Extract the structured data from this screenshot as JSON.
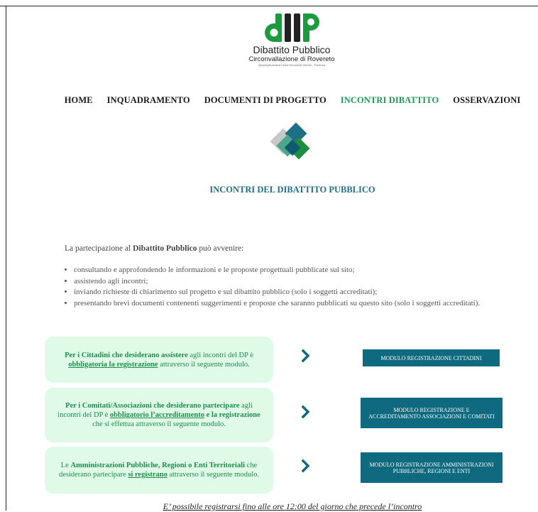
{
  "logo": {
    "title": "Dibattito Pubblico",
    "subtitle": "Circonvallazione di Rovereto",
    "tagline": "Quadruplicamento linea ferroviaria Verona - Fortezza",
    "colors": {
      "green": "#1d9a3e",
      "dark": "#222222"
    }
  },
  "nav": {
    "items": [
      {
        "label": "HOME",
        "active": false
      },
      {
        "label": "INQUADRAMENTO",
        "active": false
      },
      {
        "label": "DOCUMENTI DI PROGETTO",
        "active": false
      },
      {
        "label": "INCONTRI DIBATTITO",
        "active": true
      },
      {
        "label": "OSSERVAZIONI",
        "active": false
      }
    ]
  },
  "page": {
    "title": "INCONTRI DEL DIBATTITO PUBBLICO",
    "intro_pre": "La partecipazione al ",
    "intro_bold": "Dibattito Pubblico",
    "intro_post": " può avvenire:",
    "bullets": [
      "consultando e approfondendo le informazioni e le proposte progettuali pubblicate sul sito;",
      "assistendo agli incontri;",
      "inviando richieste di chiarimento sul progetto e sul dibattito pubblico (solo i soggetti accreditati);",
      "presentando brevi documenti contenenti suggerimenti e proposte che saranno pubblicati su questo sito (solo i soggetti accreditati)."
    ]
  },
  "registration": {
    "cittadini": {
      "bold1": "Per i Cittadini che desiderano assistere",
      "text1": " agli incontri del DP è ",
      "underline": "obbligatoria la registrazione",
      "text2": " attraverso il seguente modulo.",
      "button": "MODULO REGISTRAZIONE CITTADINI"
    },
    "comitati": {
      "bold1": "Per i Comitati/Associazioni che desiderano partecipare",
      "text1": " agli incontri del DP è ",
      "underline": "obbligatorio l’accreditamento",
      "bold2": " e la registrazione",
      "text2": " che si effettua attraverso il seguente modulo.",
      "button": "MODULO REGISTRAZIONE E ACCREDITAMENTO ASSOCIAZIONI E COMITATI"
    },
    "amministrazioni": {
      "text0": "Le ",
      "bold1": "Amministrazioni Pubbliche, Regioni o Enti Territoriali",
      "text1": " che desiderano partecipare ",
      "underline": "si registrano",
      "text2": " attraverso il seguente modulo.",
      "button": "MODULO REGISTRAZIONE AMMINISTRAZIONI PUBBLICHE, REGIONI E ENTI"
    }
  },
  "footer_note": "E’ possibile registrarsi fino alle ore 12:00 del giorno che precede l’incontro",
  "colors": {
    "accent_green": "#1d9a56",
    "teal": "#0f6a7f",
    "box_bg": "#dffbe8"
  }
}
